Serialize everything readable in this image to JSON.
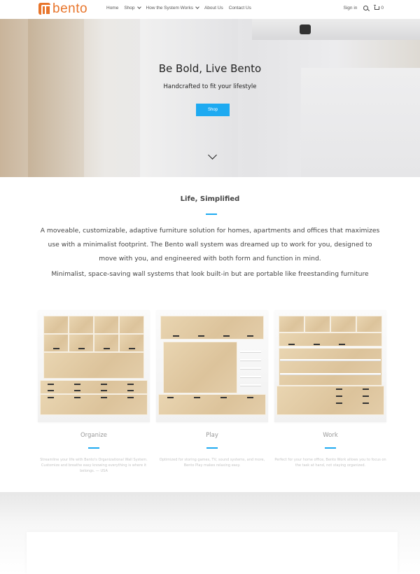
{
  "nav": {
    "logo_text": "bento",
    "menu": [
      {
        "label": "Home",
        "dropdown": false
      },
      {
        "label": "Shop",
        "dropdown": true
      },
      {
        "label": "How the System Works",
        "dropdown": true
      },
      {
        "label": "About Us",
        "dropdown": false
      },
      {
        "label": "Contact Us",
        "dropdown": false
      }
    ],
    "sign_in": "Sign in",
    "cart_count": "0",
    "icons": [
      "search-icon",
      "cart-icon",
      "chevron-down-icon"
    ]
  },
  "hero": {
    "title": "Be Bold, Live Bento",
    "subtitle": "Handcrafted to fit your lifestyle",
    "button": "Shop"
  },
  "intro": {
    "title": "Life, Simplified",
    "paragraph1": "A moveable, customizable, adaptive furniture solution for homes, apartments and offices that maximizes use with a minimalist footprint.  The Bento wall system was dreamed up to work for you, designed to move with you, and engineered with both form and function in mind.",
    "paragraph2": "Minimalist, space-saving wall systems that look built-in but are portable like freestanding furniture"
  },
  "products": [
    {
      "title": "Organize",
      "description": "Streamline your life with Bento's Organizational Wall System. Customize and breathe easy knowing everything is where it belongs. — USA"
    },
    {
      "title": "Play",
      "description": "Optimized for storing games, TV, sound systems, and more, Bento Play makes relaxing easy."
    },
    {
      "title": "Work",
      "description": "Perfect for your home office, Bento Work allows you to focus on the task at hand, not staying organized."
    }
  ],
  "colors": {
    "brand": "#e8752b",
    "accent": "#1eaaf1",
    "wood": "#e2cba5"
  }
}
